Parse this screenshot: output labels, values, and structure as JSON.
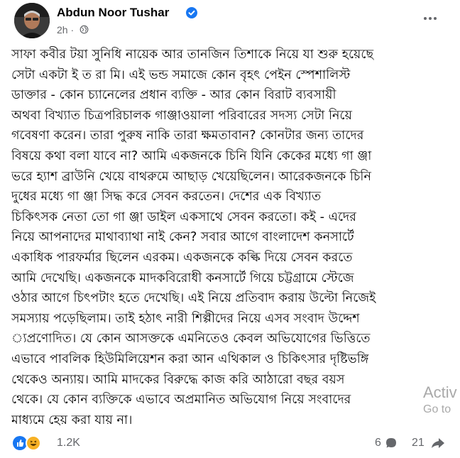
{
  "post": {
    "author_name": "Abdun Noor Tushar",
    "time_ago": "2h",
    "body_lines": [
      "সাফা কবীর টয়া সুনিধি নায়েক আর তানজিন তিশাকে নিয়ে যা শুরু হয়েছে",
      "সেটা একটা ই ত রা মি। এই ভন্ড সমাজে কোন বৃহৎ পেইন স্পেশালিস্ট",
      "ডাক্তার - কোন চ্যানেলের প্রধান ব্যক্তি - আর কোন বিরাট ব্যবসায়ী",
      "অথবা বিখ্যাত চিত্রপরিচালক গাঞ্জাওয়ালা পরিবারের সদস্য সেটা নিয়ে",
      "গবেষণা করেন। তারা পুরুষ নাকি তারা ক্ষমতাবান? কোনটার জন্য তাদের",
      "বিষয়ে কথা বলা যাবে না? আমি একজনকে চিনি যিনি কেকের মধ্যে গা ঞ্জা",
      "ভরে হ্যাশ ব্রাউনি খেয়ে বাথরুমে আছাড় খেয়েছিলেন। আরেকজনকে চিনি",
      "দুধের মধ্যে গা ঞ্জা সিদ্ধ করে সেবন করতেন। দেশের এক বিখ্যাত",
      "চিকিৎসক নেতা তো গা ঞ্জা ডাইল একসাথে সেবন করতো। কই - এদের",
      "নিয়ে আপনাদের মাথাব্যাথা নাই কেন? সবার আগে বাংলাদেশ কনসার্টে",
      "একাধিক পারফর্মার ছিলেন এরকম। একজনকে কল্কি দিয়ে সেবন করতে",
      "আমি দেখেছি। একজনকে মাদকবিরোধী কনসার্টে গিয়ে চট্টগ্রামে স্টেজে",
      "ওঠার আগে চিৎপটাং হতে দেখেছি। এই নিয়ে প্রতিবাদ করায় উল্টো নিজেই",
      "সমস্যায় পড়েছিলাম। তাই হঠাৎ নারী শিল্পীদের নিয়ে এসব সংবাদ উদ্দেশ",
      "্যপ্রণোদিত। যে কোন আসক্তকে এমনিতেও কেবল অভিযোগের ভিত্তিতে",
      "এভাবে পাবলিক হিউমিলিয়েশন করা আন এথিকাল ও চিকিৎসার দৃষ্টিভঙ্গি",
      "থেকেও অন্যায়। আমি মাদকের বিরুদ্ধে কাজ করি আঠারো বছর বয়স",
      "থেকে। যে কোন ব্যক্তিকে এভাবে অপ্রমানিত অভিযোগ নিয়ে সংবাদের",
      "মাধ্যমে হেয় করা যায় না।"
    ],
    "reaction_count": "1.2K",
    "comment_count": "6",
    "share_count": "21"
  },
  "watermark": {
    "line1": "Activ",
    "line2": "Go to"
  },
  "icons": {
    "verified": "verified-badge-icon",
    "privacy": "globe-icon",
    "more": "more-options-icon",
    "like": "like-reaction-icon",
    "haha": "haha-reaction-icon",
    "comment": "comment-icon",
    "share": "share-icon"
  },
  "colors": {
    "accent": "#1877f2",
    "haha": "#f7b125",
    "secondary_text": "#65676b"
  }
}
